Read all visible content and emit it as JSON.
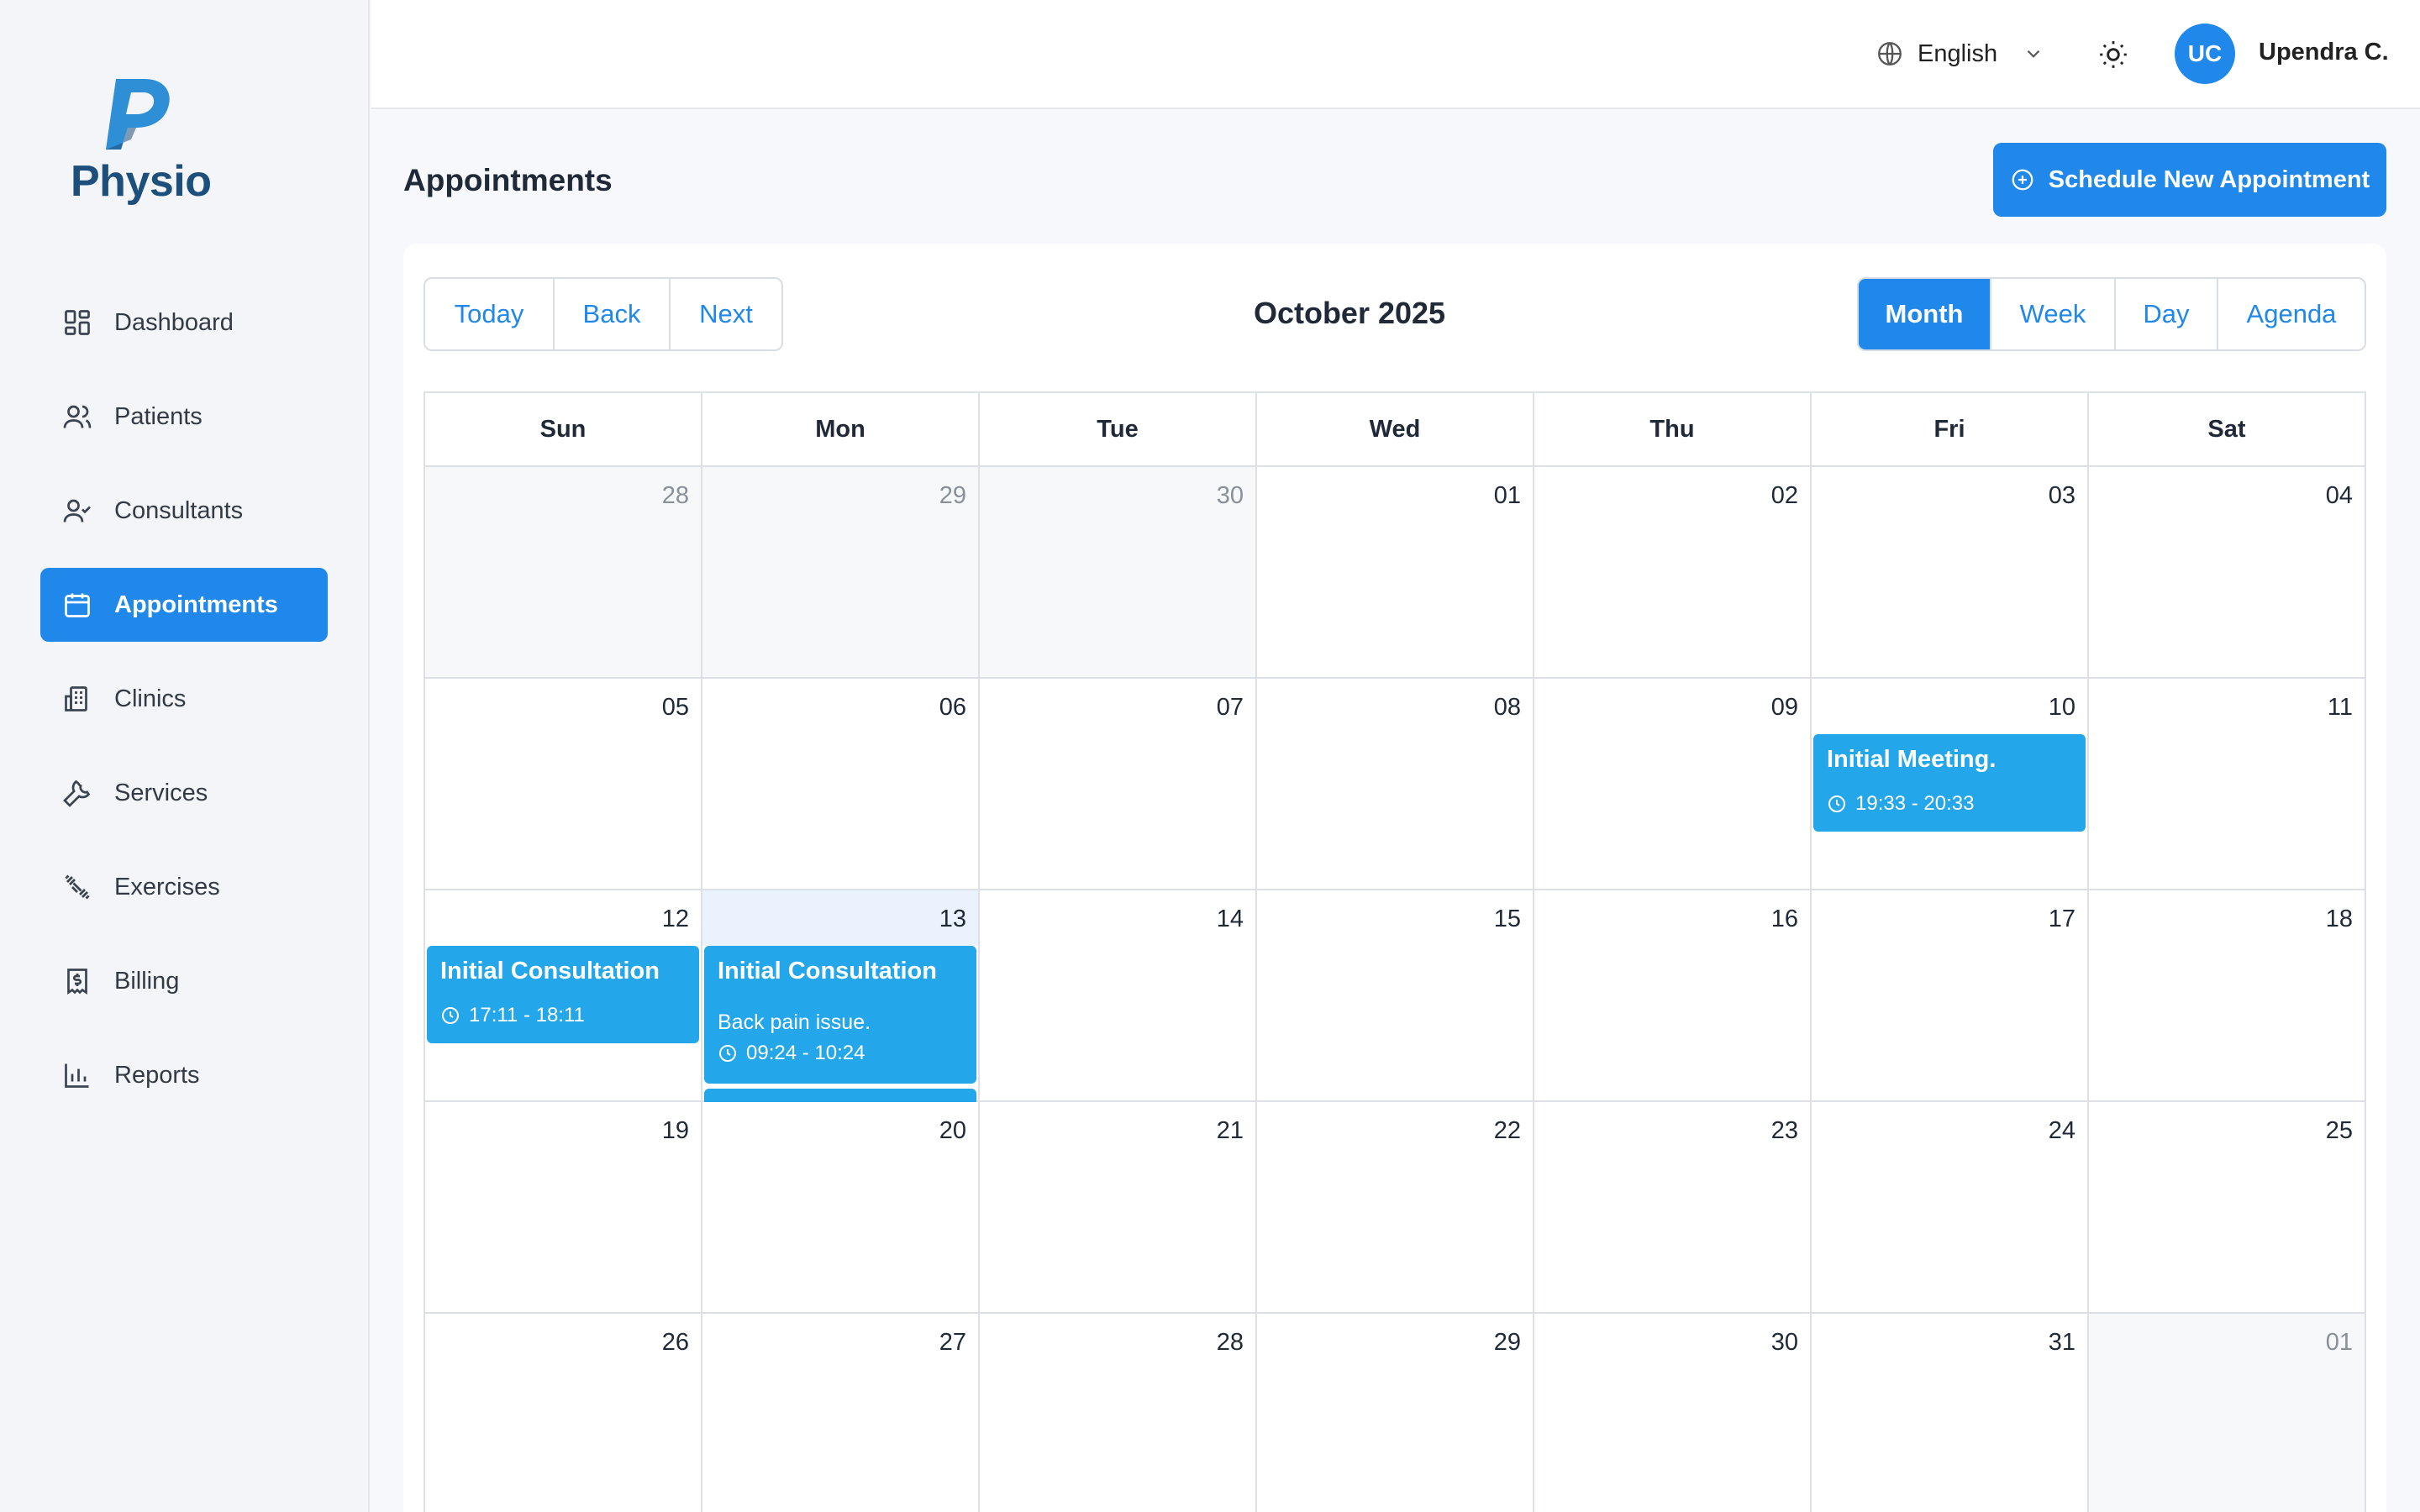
{
  "app": {
    "logo_text": "Physio"
  },
  "sidebar": {
    "items": [
      {
        "label": "Dashboard",
        "icon": "dashboard-icon"
      },
      {
        "label": "Patients",
        "icon": "users-icon"
      },
      {
        "label": "Consultants",
        "icon": "user-check-icon"
      },
      {
        "label": "Appointments",
        "icon": "calendar-icon",
        "active": true
      },
      {
        "label": "Clinics",
        "icon": "building-icon"
      },
      {
        "label": "Services",
        "icon": "wrench-icon"
      },
      {
        "label": "Exercises",
        "icon": "dumbbell-icon"
      },
      {
        "label": "Billing",
        "icon": "receipt-icon"
      },
      {
        "label": "Reports",
        "icon": "bar-chart-icon"
      }
    ]
  },
  "header": {
    "language": "English",
    "avatar_initials": "UC",
    "user_name": "Upendra C."
  },
  "page": {
    "title": "Appointments",
    "schedule_button": "Schedule New Appointment"
  },
  "calendar": {
    "nav_buttons": [
      "Today",
      "Back",
      "Next"
    ],
    "month_label": "October 2025",
    "views": [
      "Month",
      "Week",
      "Day",
      "Agenda"
    ],
    "active_view": "Month",
    "weekdays": [
      "Sun",
      "Mon",
      "Tue",
      "Wed",
      "Thu",
      "Fri",
      "Sat"
    ],
    "weeks": [
      [
        "28",
        "29",
        "30",
        "01",
        "02",
        "03",
        "04"
      ],
      [
        "05",
        "06",
        "07",
        "08",
        "09",
        "10",
        "11"
      ],
      [
        "12",
        "13",
        "14",
        "15",
        "16",
        "17",
        "18"
      ],
      [
        "19",
        "20",
        "21",
        "22",
        "23",
        "24",
        "25"
      ],
      [
        "26",
        "27",
        "28",
        "29",
        "30",
        "31",
        "01"
      ]
    ],
    "events": [
      {
        "title": "Initial Meeting.",
        "time": "19:33 - 20:33"
      },
      {
        "title": "Initial Consultation",
        "time": "17:11 - 18:11"
      },
      {
        "title": "Initial Consultation",
        "description": "Back pain issue.",
        "time": "09:24 - 10:24"
      }
    ]
  },
  "colors": {
    "accent": "#2088ea",
    "event": "#23a6ea",
    "brand_dark": "#1d4f7c"
  }
}
